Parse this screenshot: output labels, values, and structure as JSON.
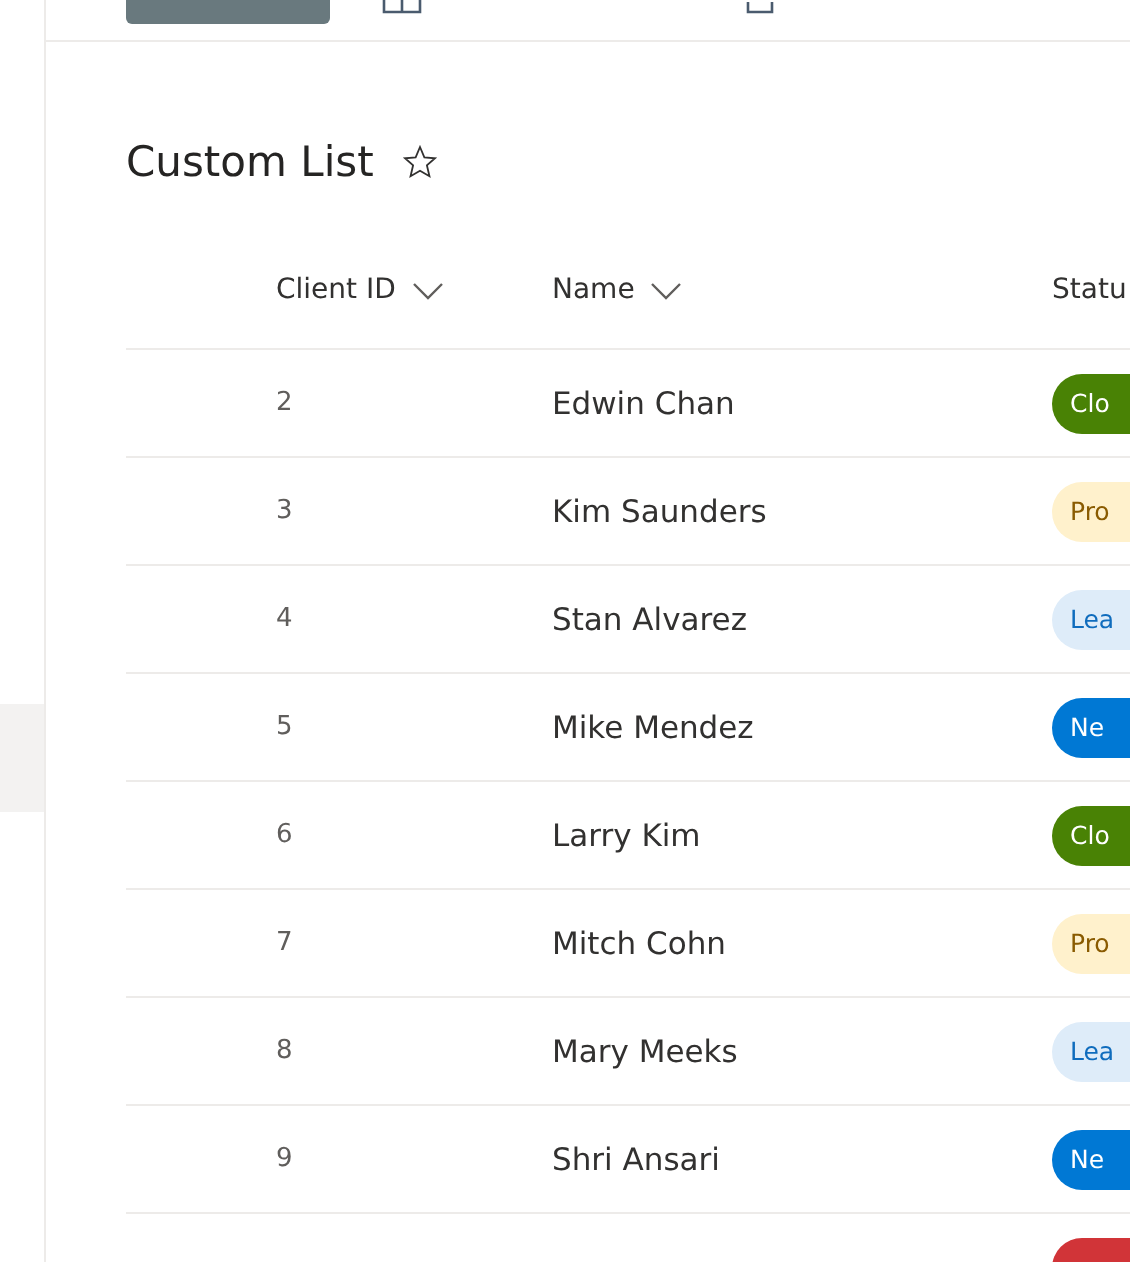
{
  "nav": {
    "items": [
      {
        "selected": true
      }
    ]
  },
  "list": {
    "title": "Custom List",
    "favorite": false
  },
  "table": {
    "columns": [
      {
        "label": "Client ID",
        "sortable": true
      },
      {
        "label": "Name",
        "sortable": true
      },
      {
        "label": "Statu",
        "sortable": false
      }
    ],
    "rows": [
      {
        "id": "2",
        "name": "Edwin Chan",
        "status": {
          "label": "Clo",
          "kind": "green"
        }
      },
      {
        "id": "3",
        "name": "Kim Saunders",
        "status": {
          "label": "Pro",
          "kind": "yellow"
        }
      },
      {
        "id": "4",
        "name": "Stan Alvarez",
        "status": {
          "label": "Lea",
          "kind": "lightblue"
        }
      },
      {
        "id": "5",
        "name": "Mike Mendez",
        "status": {
          "label": "Ne",
          "kind": "blue"
        }
      },
      {
        "id": "6",
        "name": "Larry Kim",
        "status": {
          "label": "Clo",
          "kind": "green"
        }
      },
      {
        "id": "7",
        "name": "Mitch Cohn",
        "status": {
          "label": "Pro",
          "kind": "yellow"
        }
      },
      {
        "id": "8",
        "name": "Mary Meeks",
        "status": {
          "label": "Lea",
          "kind": "lightblue"
        }
      },
      {
        "id": "9",
        "name": "Shri Ansari",
        "status": {
          "label": "Ne",
          "kind": "blue"
        }
      },
      {
        "status": {
          "kind": "red"
        }
      }
    ]
  }
}
